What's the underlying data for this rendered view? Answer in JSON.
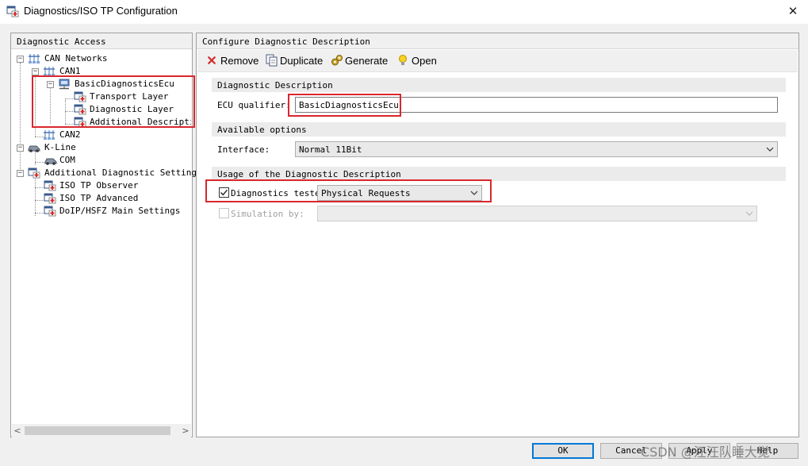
{
  "window": {
    "title": "Diagnostics/ISO TP Configuration",
    "close_glyph": "✕"
  },
  "left_panel": {
    "header": "Diagnostic Access",
    "tree": {
      "can_networks": "CAN Networks",
      "can1": "CAN1",
      "ecu": "BasicDiagnosticsEcu",
      "transport_layer": "Transport Layer",
      "diagnostic_layer": "Diagnostic Layer",
      "additional_description": "Additional Descriptio",
      "can2": "CAN2",
      "kline": "K-Line",
      "com": "COM",
      "additional_settings": "Additional Diagnostic Settings",
      "iso_tp_observer": "ISO TP Observer",
      "iso_tp_advanced": "ISO TP Advanced",
      "doip_main_settings": "DoIP/HSFZ Main Settings"
    },
    "scroll_left": "<",
    "scroll_right": ">"
  },
  "right_panel": {
    "header": "Configure Diagnostic Description",
    "toolbar": {
      "remove": "Remove",
      "duplicate": "Duplicate",
      "generate": "Generate",
      "open": "Open"
    },
    "section_description": "Diagnostic Description",
    "ecu_qualifier_label": "ECU qualifier:",
    "ecu_qualifier_value": "BasicDiagnosticsEcu",
    "section_options": "Available options",
    "interface_label": "Interface:",
    "interface_value": "Normal 11Bit",
    "section_usage": "Usage of the Diagnostic Description",
    "diagnostics_tester_label": "Diagnostics tester",
    "diagnostics_tester_checked": true,
    "diagnostics_tester_value": "Physical Requests",
    "simulation_label": "Simulation by:",
    "simulation_checked": false,
    "simulation_value": ""
  },
  "buttons": {
    "ok": "OK",
    "cancel": "Cancel",
    "apply": "Apply",
    "help": "Help"
  },
  "watermark": "CSDN @汪汪队睡大觉",
  "colors": {
    "highlight_red": "#d9272e",
    "focus_blue": "#0078d7",
    "remove_red": "#d62b2b"
  }
}
